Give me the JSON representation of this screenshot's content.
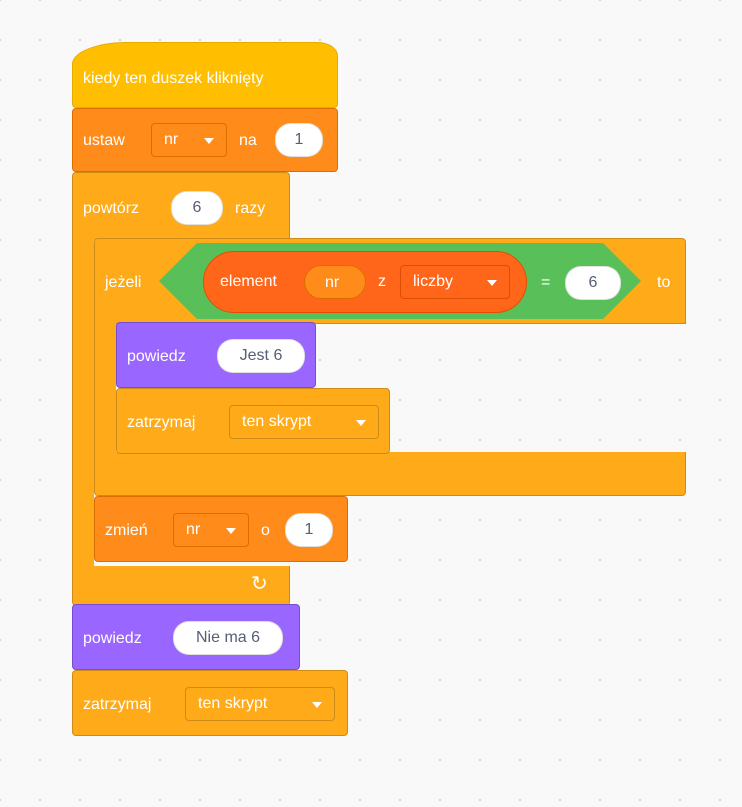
{
  "script": {
    "hat": {
      "label": "kiedy ten duszek kliknięty"
    },
    "set_block": {
      "label": "ustaw",
      "variable": "nr",
      "connector": "na",
      "value": "1"
    },
    "repeat_block": {
      "label": "powtórz",
      "count": "6",
      "suffix": "razy"
    },
    "if_block": {
      "label": "jeżeli",
      "then": "to",
      "condition": {
        "item_label": "element",
        "index_var": "nr",
        "of_label": "z",
        "list": "liczby",
        "operator": "=",
        "compare_value": "6"
      }
    },
    "say_inside": {
      "label": "powiedz",
      "text": "Jest 6"
    },
    "stop_inside": {
      "label": "zatrzymaj",
      "option": "ten skrypt"
    },
    "change_block": {
      "label": "zmień",
      "variable": "nr",
      "connector": "o",
      "value": "1"
    },
    "loop_arrow": "↻",
    "say_after": {
      "label": "powiedz",
      "text": "Nie ma 6"
    },
    "stop_after": {
      "label": "zatrzymaj",
      "option": "ten skrypt"
    }
  },
  "colors": {
    "events": "#ffbf00",
    "control": "#ffab19",
    "variables": "#ff8c1a",
    "looks": "#9966ff",
    "operators": "#59c059",
    "list_reporter": "#ff661a"
  }
}
